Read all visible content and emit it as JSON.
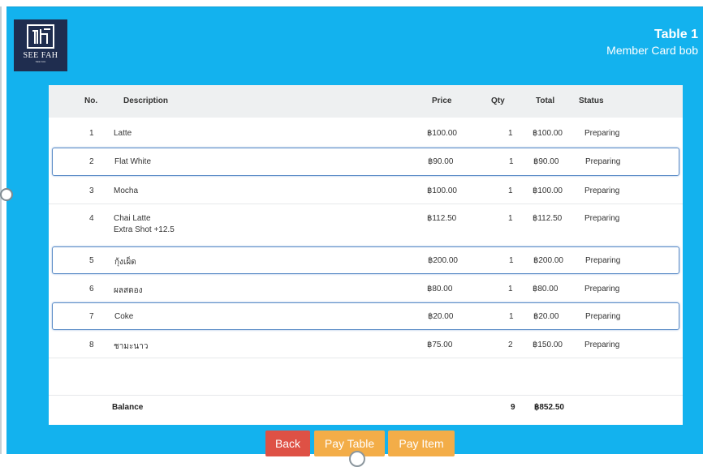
{
  "brand": {
    "name": "SEE FAH",
    "sub": "SEE FAH"
  },
  "header": {
    "table": "Table 1",
    "member": "Member Card bob"
  },
  "columns": {
    "no": "No.",
    "description": "Description",
    "price": "Price",
    "qty": "Qty",
    "total": "Total",
    "status": "Status"
  },
  "items": [
    {
      "no": "1",
      "desc": "Latte",
      "price": "฿100.00",
      "qty": "1",
      "total": "฿100.00",
      "status": "Preparing"
    },
    {
      "no": "2",
      "desc": "Flat White",
      "price": "฿90.00",
      "qty": "1",
      "total": "฿90.00",
      "status": "Preparing"
    },
    {
      "no": "3",
      "desc": "Mocha",
      "price": "฿100.00",
      "qty": "1",
      "total": "฿100.00",
      "status": "Preparing"
    },
    {
      "no": "4",
      "desc": "Chai Latte",
      "sub": "Extra Shot +12.5",
      "price": "฿112.50",
      "qty": "1",
      "total": "฿112.50",
      "status": "Preparing"
    },
    {
      "no": "5",
      "desc": "กุ้งเผ็ด",
      "price": "฿200.00",
      "qty": "1",
      "total": "฿200.00",
      "status": "Preparing"
    },
    {
      "no": "6",
      "desc": "ผลสดอง",
      "price": "฿80.00",
      "qty": "1",
      "total": "฿80.00",
      "status": "Preparing"
    },
    {
      "no": "7",
      "desc": "Coke",
      "price": "฿20.00",
      "qty": "1",
      "total": "฿20.00",
      "status": "Preparing"
    },
    {
      "no": "8",
      "desc": "ชามะนาว",
      "price": "฿75.00",
      "qty": "2",
      "total": "฿150.00",
      "status": "Preparing"
    }
  ],
  "balance": {
    "label": "Balance",
    "qty": "9",
    "total": "฿852.50"
  },
  "buttons": {
    "back": "Back",
    "pay_table": "Pay Table",
    "pay_item": "Pay Item"
  },
  "colors": {
    "background": "#13b2ee",
    "back": "#de5145",
    "pay": "#f3ad48",
    "highlight_border": "#5b8cc7"
  }
}
